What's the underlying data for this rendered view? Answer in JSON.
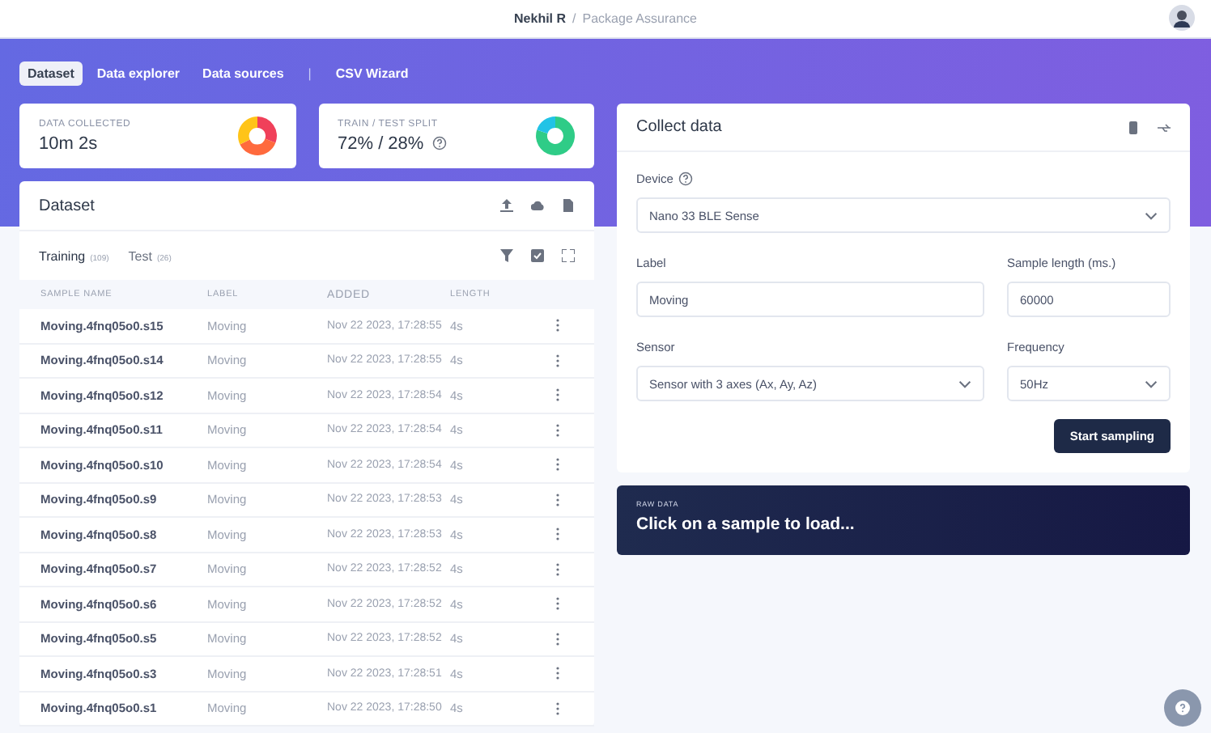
{
  "header": {
    "user": "Nekhil R",
    "separator": "/",
    "project": "Package Assurance"
  },
  "nav": [
    {
      "kind": "tab",
      "label": "Dataset",
      "selected": true
    },
    {
      "kind": "tab",
      "label": "Data explorer",
      "selected": false
    },
    {
      "kind": "tab",
      "label": "Data sources",
      "selected": false
    },
    {
      "kind": "divider",
      "label": "|"
    },
    {
      "kind": "tab",
      "label": "CSV Wizard",
      "selected": false
    }
  ],
  "stats": [
    {
      "label": "DATA COLLECTED",
      "value": "10m 2s",
      "help": false
    },
    {
      "label": "TRAIN / TEST SPLIT",
      "value": "72% / 28%",
      "help": true
    }
  ],
  "dataset": {
    "title": "Dataset",
    "tabs": [
      {
        "label": "Training",
        "count": "(109)",
        "selected": true
      },
      {
        "label": "Test",
        "count": "(26)",
        "selected": false
      }
    ],
    "columns": [
      "SAMPLE NAME",
      "LABEL",
      "ADDED",
      "LENGTH"
    ],
    "rows": [
      {
        "name": "Moving.4fnq05o0.s15",
        "label": "Moving",
        "added": "Nov 22 2023, 17:28:55",
        "length": "4s"
      },
      {
        "name": "Moving.4fnq05o0.s14",
        "label": "Moving",
        "added": "Nov 22 2023, 17:28:55",
        "length": "4s"
      },
      {
        "name": "Moving.4fnq05o0.s12",
        "label": "Moving",
        "added": "Nov 22 2023, 17:28:54",
        "length": "4s"
      },
      {
        "name": "Moving.4fnq05o0.s11",
        "label": "Moving",
        "added": "Nov 22 2023, 17:28:54",
        "length": "4s"
      },
      {
        "name": "Moving.4fnq05o0.s10",
        "label": "Moving",
        "added": "Nov 22 2023, 17:28:54",
        "length": "4s"
      },
      {
        "name": "Moving.4fnq05o0.s9",
        "label": "Moving",
        "added": "Nov 22 2023, 17:28:53",
        "length": "4s"
      },
      {
        "name": "Moving.4fnq05o0.s8",
        "label": "Moving",
        "added": "Nov 22 2023, 17:28:53",
        "length": "4s"
      },
      {
        "name": "Moving.4fnq05o0.s7",
        "label": "Moving",
        "added": "Nov 22 2023, 17:28:52",
        "length": "4s"
      },
      {
        "name": "Moving.4fnq05o0.s6",
        "label": "Moving",
        "added": "Nov 22 2023, 17:28:52",
        "length": "4s"
      },
      {
        "name": "Moving.4fnq05o0.s5",
        "label": "Moving",
        "added": "Nov 22 2023, 17:28:52",
        "length": "4s"
      },
      {
        "name": "Moving.4fnq05o0.s3",
        "label": "Moving",
        "added": "Nov 22 2023, 17:28:51",
        "length": "4s"
      },
      {
        "name": "Moving.4fnq05o0.s1",
        "label": "Moving",
        "added": "Nov 22 2023, 17:28:50",
        "length": "4s"
      }
    ]
  },
  "collect": {
    "title": "Collect data",
    "device": {
      "label": "Device",
      "value": "Nano 33 BLE Sense"
    },
    "label": {
      "label": "Label",
      "value": "Moving"
    },
    "sample_length": {
      "label": "Sample length (ms.)",
      "value": "60000"
    },
    "sensor": {
      "label": "Sensor",
      "value": "Sensor with 3 axes (Ax, Ay, Az)"
    },
    "frequency": {
      "label": "Frequency",
      "value": "50Hz"
    },
    "button": "Start sampling"
  },
  "raw_data": {
    "label": "RAW DATA",
    "message": "Click on a sample to load..."
  }
}
